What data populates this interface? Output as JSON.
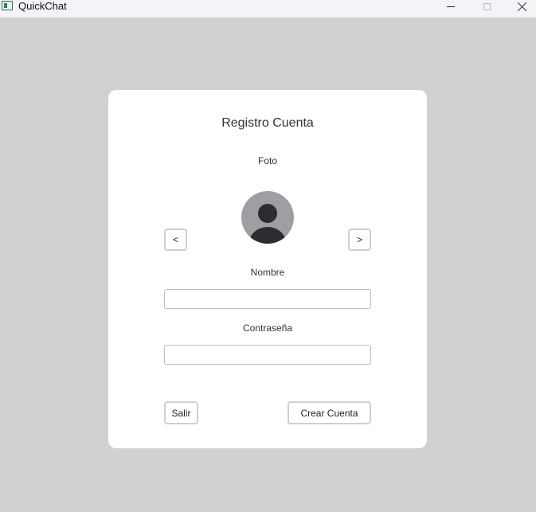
{
  "window": {
    "title": "QuickChat",
    "background": "#d1d1d1"
  },
  "form": {
    "title": "Registro Cuenta",
    "photo_label": "Foto",
    "prev_label": "<",
    "next_label": ">",
    "name_label": "Nombre",
    "name_value": "",
    "password_label": "Contraseña",
    "password_value": "",
    "exit_label": "Salir",
    "create_label": "Crear Cuenta"
  },
  "icons": {
    "app": "app-icon",
    "avatar": "default-user-avatar-icon"
  },
  "colors": {
    "card": "#ffffff",
    "avatar_bg": "#9e9fa2",
    "avatar_fg": "#2b2d31",
    "button_border": "#cfcfcf"
  }
}
